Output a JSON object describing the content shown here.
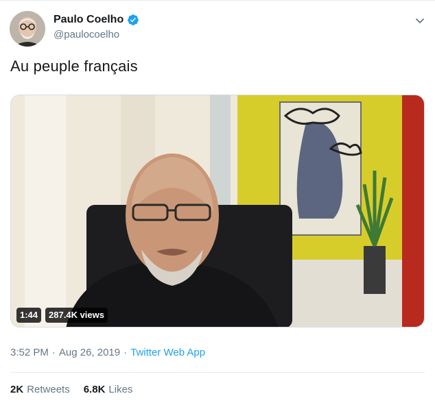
{
  "tweet": {
    "author": {
      "display_name": "Paulo Coelho",
      "handle": "@paulocoelho",
      "verified": true
    },
    "text": "Au peuple français",
    "video": {
      "duration": "1:44",
      "views": "287.4K views"
    },
    "meta": {
      "time": "3:52 PM",
      "separator_1": "·",
      "date": "Aug 26, 2019",
      "separator_2": "·",
      "source": "Twitter Web App"
    },
    "stats": {
      "retweets_count": "2K",
      "retweets_label": "Retweets",
      "likes_count": "6.8K",
      "likes_label": "Likes"
    }
  },
  "icons": {
    "verified": "verified-badge-icon",
    "more": "chevron-down-icon"
  },
  "colors": {
    "accent": "#1da1f2",
    "secondary_text": "#657786",
    "primary_text": "#14171a",
    "divider": "#e6ecf0"
  }
}
